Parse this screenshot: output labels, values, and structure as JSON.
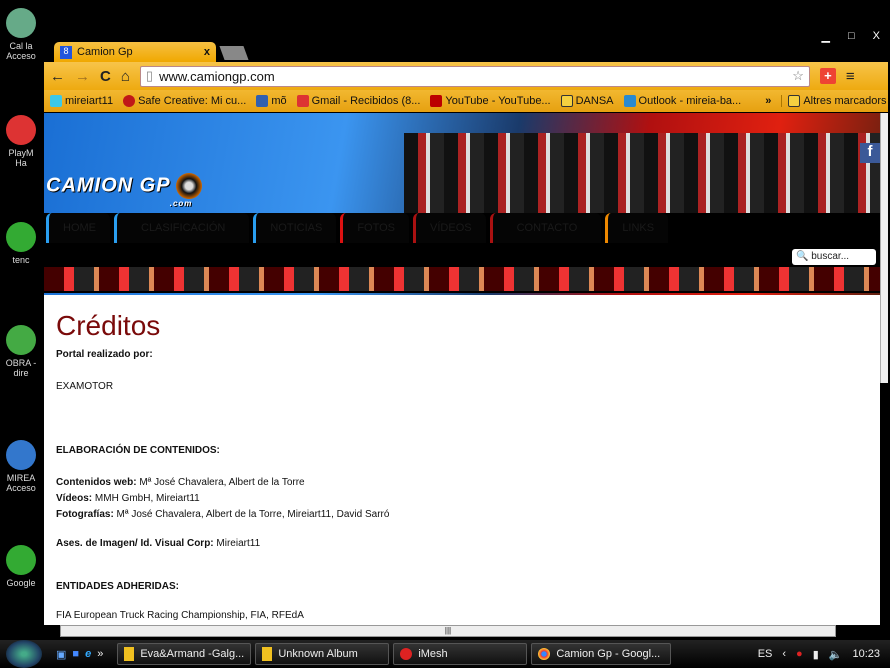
{
  "desktop": {
    "icons": [
      "Cal la\nAcceso",
      "PlayM\nHa",
      "tenc",
      "OBRA -\ndire",
      "MIREA\nAcceso",
      "Google"
    ]
  },
  "window": {
    "minimize": "▁",
    "maximize": "□",
    "close": "X"
  },
  "tab": {
    "favicon": "8",
    "title": "Camion Gp",
    "close": "x"
  },
  "toolbar": {
    "back": "←",
    "forward": "→",
    "reload": "C",
    "home": "⌂",
    "url": "www.camiongp.com",
    "star": "☆",
    "ext": "+",
    "menu": "≡"
  },
  "bookmarks": {
    "items": [
      {
        "label": "mireiart11",
        "color": "#3cc8e8"
      },
      {
        "label": "Safe Creative: Mi cu...",
        "color": "#c01818"
      },
      {
        "label": "mõ",
        "color": "#3060b0"
      },
      {
        "label": "Gmail - Recibidos (8...",
        "color": "#d33"
      },
      {
        "label": "YouTube - YouTube...",
        "color": "#b00"
      },
      {
        "label": "DANSA",
        "color": "#f5d040"
      },
      {
        "label": "Outlook - mireia-ba...",
        "color": "#2a8ad0"
      }
    ],
    "more": "»",
    "other": "Altres marcadors"
  },
  "site": {
    "logo": "CAMION GP",
    "logo_sub": ".com",
    "nav": [
      "HOME",
      "CLASIFICACIÓN",
      "NOTICIAS",
      "FOTOS",
      "VÍDEOS",
      "CONTACTO",
      "LINKS"
    ],
    "search_placeholder": "buscar...",
    "fb": "f"
  },
  "content": {
    "title": "Créditos",
    "portal_label": "Portal realizado por:",
    "portal_value": "EXAMOTOR",
    "elab_heading": "ELABORACIÓN DE CONTENIDOS:",
    "web_label": "Contenidos web:",
    "web_value": " Mª José Chavalera, Albert de la Torre",
    "videos_label": "Vídeos:",
    "videos_value": " MMH GmbH, Mireiart11",
    "fotos_label": "Fotografías:",
    "fotos_value": " Mª José Chavalera, Albert de la Torre, Mireiart11, David Sarró",
    "ases_label": "Ases. de Imagen/ Id. Visual Corp:",
    "ases_value": " Mireiart11",
    "ent_heading": "ENTIDADES ADHERIDAS:",
    "ent_value": "FIA European Truck Racing Championship, FIA, RFEdA"
  },
  "taskbar": {
    "more": "»",
    "items": [
      "Eva&Armand -Galg...",
      "Unknown Album",
      "iMesh",
      "Camion Gp - Googl..."
    ],
    "lang": "ES",
    "chevron": "‹",
    "clock": "10:23"
  }
}
